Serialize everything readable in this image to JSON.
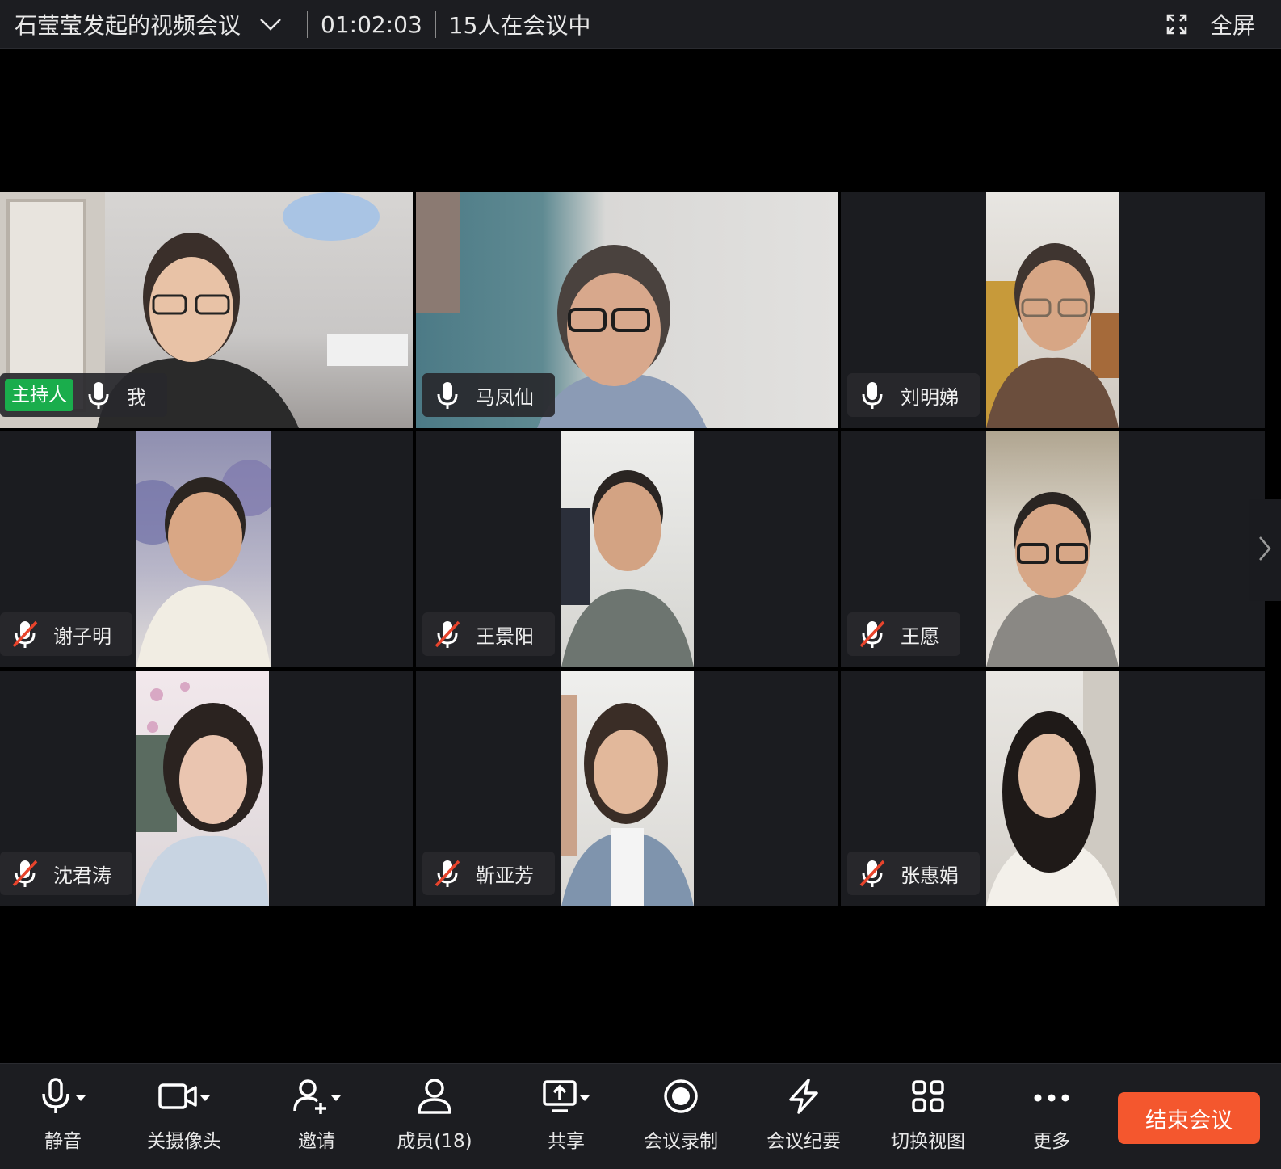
{
  "header": {
    "title": "石莹莹发起的视频会议",
    "timer": "01:02:03",
    "participant_count": "15人在会议中",
    "fullscreen_label": "全屏"
  },
  "participants": [
    {
      "name": "我",
      "host_badge": "主持人",
      "mic": "on"
    },
    {
      "name": "马凤仙",
      "mic": "on"
    },
    {
      "name": "刘明娣",
      "mic": "on"
    },
    {
      "name": "谢子明",
      "mic": "muted"
    },
    {
      "name": "王景阳",
      "mic": "muted"
    },
    {
      "name": "王愿",
      "mic": "muted"
    },
    {
      "name": "沈君涛",
      "mic": "muted"
    },
    {
      "name": "靳亚芳",
      "mic": "muted"
    },
    {
      "name": "张惠娟",
      "mic": "muted"
    }
  ],
  "toolbar": {
    "mute": "静音",
    "camera": "关摄像头",
    "invite": "邀请",
    "members": "成员(18)",
    "share": "共享",
    "record": "会议录制",
    "minutes": "会议纪要",
    "switch_view": "切换视图",
    "more": "更多",
    "end": "结束会议"
  },
  "colors": {
    "host_badge": "#1aad4c",
    "end_button": "#f4572e",
    "muted_slash": "#e8442c"
  }
}
